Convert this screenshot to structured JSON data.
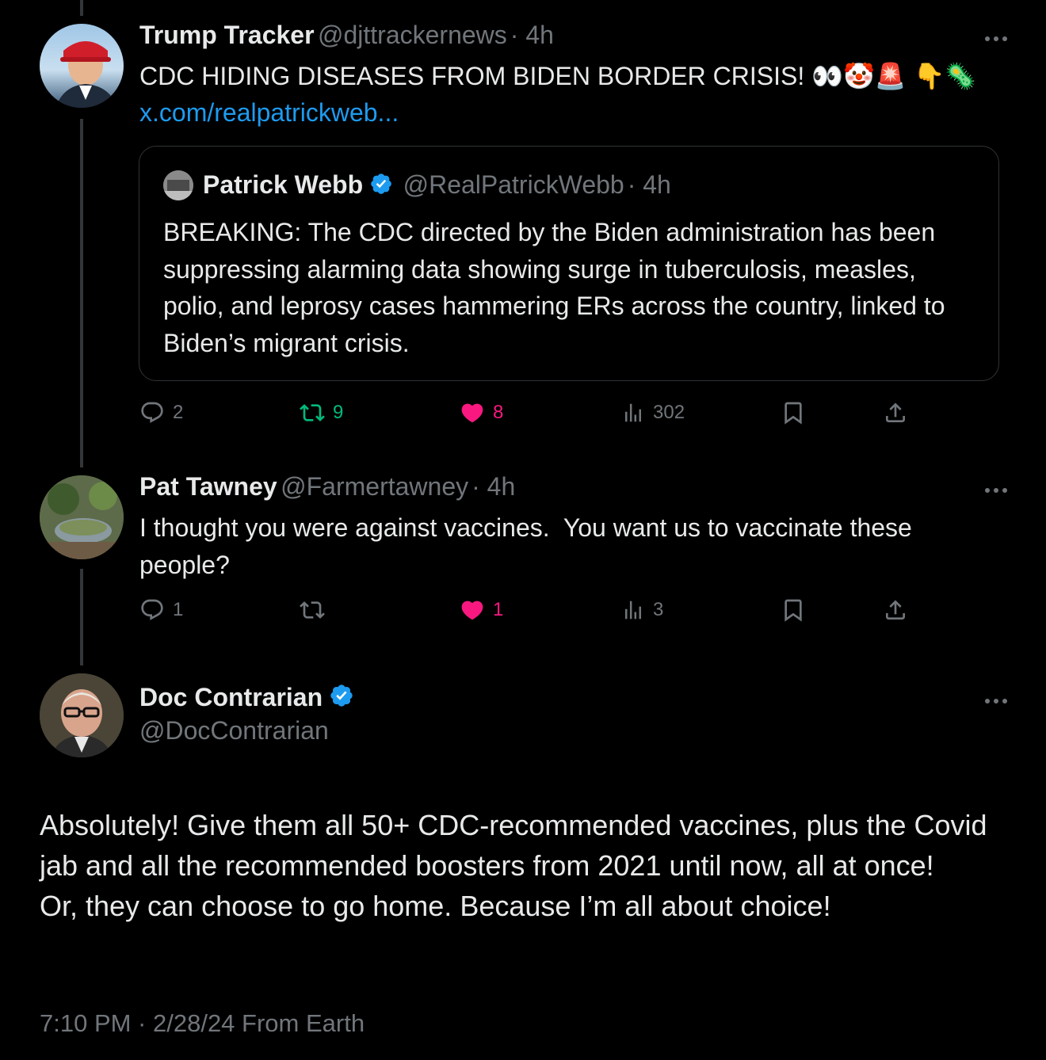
{
  "tweets": [
    {
      "name": "Trump Tracker",
      "handle": "@djttrackernews",
      "time": "· 4h",
      "text": "CDC HIDING DISEASES FROM BIDEN BORDER CRISIS! 👀🤡🚨 👇🦠",
      "link": "x.com/realpatrickweb...",
      "quote": {
        "name": "Patrick Webb",
        "handle": "@RealPatrickWebb",
        "time": "· 4h",
        "text": "BREAKING: The CDC directed by the Biden administration has been suppressing alarming data showing surge in tuberculosis, measles, polio, and leprosy cases hammering ERs across the country, linked to Biden’s migrant crisis."
      },
      "actions": {
        "replies": "2",
        "reposts": "9",
        "likes": "8",
        "views": "302"
      }
    },
    {
      "name": "Pat Tawney",
      "handle": "@Farmertawney",
      "time": "· 4h",
      "text": "I thought you were against vaccines.  You want us to vaccinate these people?",
      "actions": {
        "replies": "1",
        "reposts": "",
        "likes": "1",
        "views": "3"
      }
    }
  ],
  "main": {
    "name": "Doc Contrarian",
    "handle": "@DocContrarian",
    "text_line1": "Absolutely! Give them all 50+ CDC-recommended vaccines, plus the Covid jab and all the recommended boosters from 2021 until now, all at once!",
    "text_line2": "Or, they can choose to go home. Because I’m all about choice!",
    "meta": "7:10 PM · 2/28/24 From Earth"
  },
  "colors": {
    "link": "#1d9bf0",
    "retweet": "#00ba7c",
    "like": "#f91880",
    "muted": "#71767b"
  },
  "icons": [
    "more-icon",
    "verified-icon",
    "reply-icon",
    "repost-icon",
    "like-icon",
    "views-icon",
    "bookmark-icon",
    "share-icon"
  ]
}
